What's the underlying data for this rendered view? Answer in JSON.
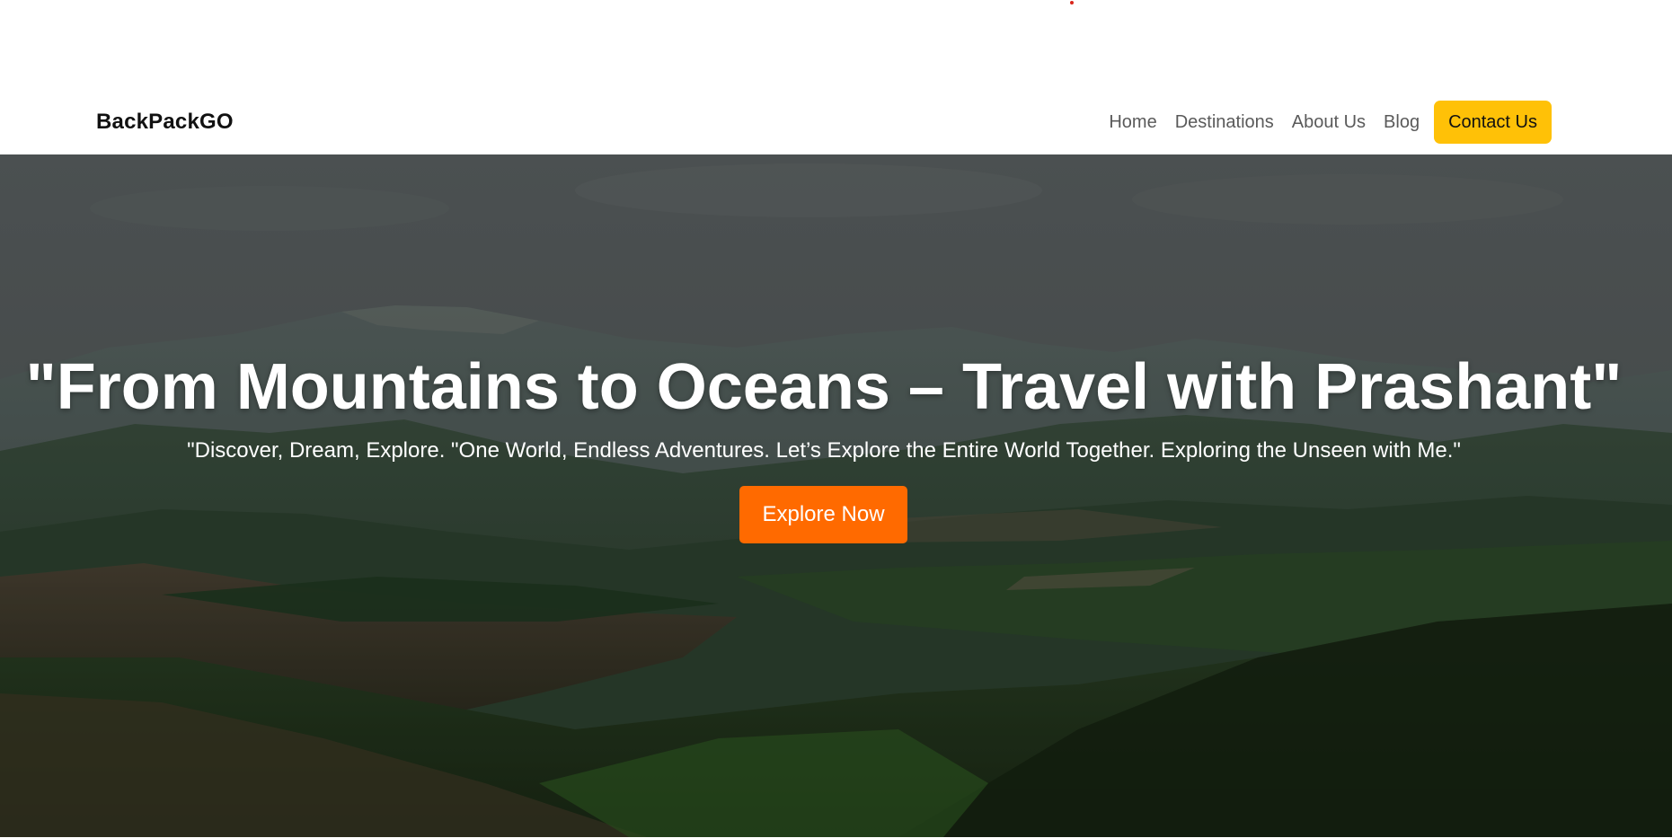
{
  "nav": {
    "brand": "BackPackGO",
    "links": [
      "Home",
      "Destinations",
      "About Us",
      "Blog"
    ],
    "contact_label": "Contact Us"
  },
  "hero": {
    "title": "\"From Mountains to Oceans – Travel with Prashant\"",
    "subtitle": "\"Discover, Dream, Explore. \"One World, Endless Adventures. Let’s Explore the Entire World Together. Exploring the Unseen with Me.\"",
    "cta_label": "Explore Now"
  },
  "colors": {
    "contact_button": "#ffc107",
    "cta_button": "#ff6a00",
    "brand_text": "#111111",
    "nav_text": "#5a5a5a"
  }
}
